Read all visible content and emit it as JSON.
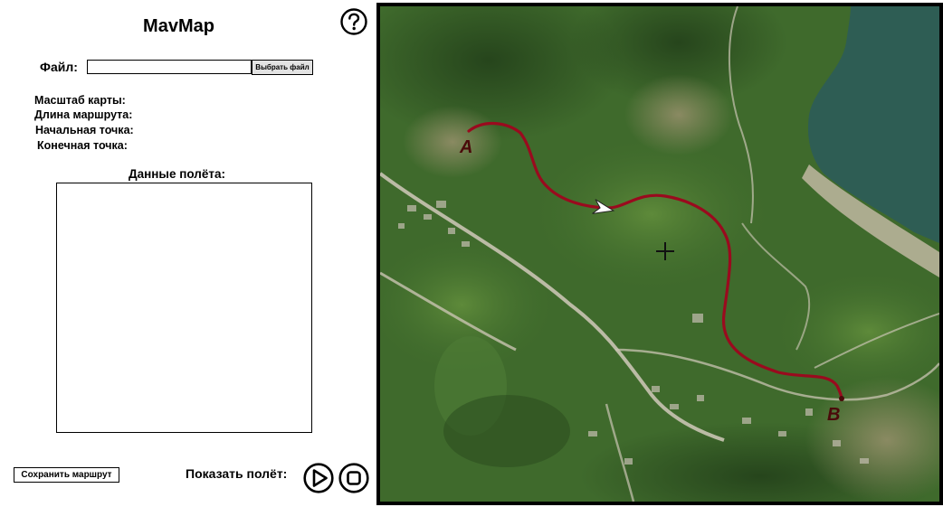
{
  "app": {
    "title": "MavMap"
  },
  "help": {
    "icon": "help-circle-icon"
  },
  "file": {
    "label": "Файл:",
    "value": "",
    "browse_label": "Выбрать файл"
  },
  "info": {
    "scale_label": "Масштаб карты:",
    "length_label": "Длина маршрута:",
    "start_label": "Начальная точка:",
    "end_label": "Конечная точка:"
  },
  "flight": {
    "label": "Данные полёта:",
    "content": ""
  },
  "footer": {
    "save_label": "Сохранить маршрут",
    "show_label": "Показать полёт:",
    "play_icon": "play-circle-icon",
    "stop_icon": "stop-circle-icon"
  },
  "map": {
    "start_marker": "A",
    "end_marker": "B",
    "route_color": "#9a0a1e",
    "marker_color": "#4a0a0a",
    "water_color": "#2e5d54",
    "vegetation_color": "#3f6a2c",
    "road_color": "#c9c4b2"
  }
}
